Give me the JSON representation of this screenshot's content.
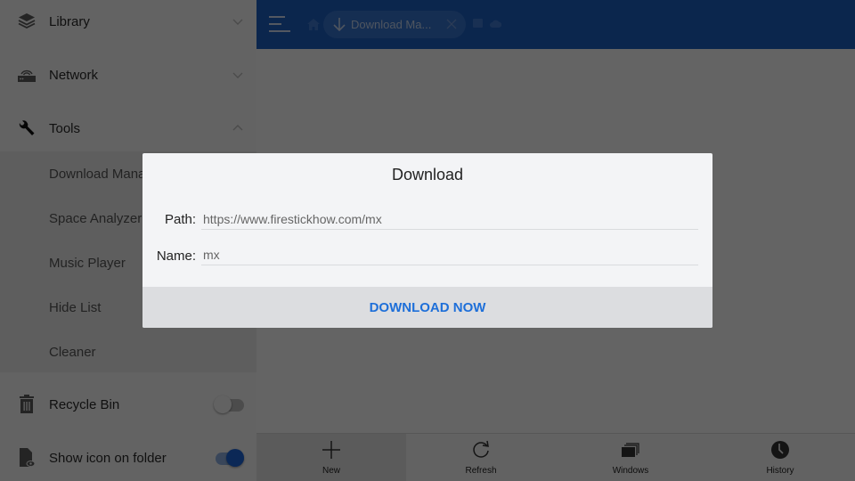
{
  "sidebar": {
    "sections": [
      {
        "label": "Library",
        "icon": "layers-icon",
        "expanded": false
      },
      {
        "label": "Network",
        "icon": "router-icon",
        "expanded": false
      },
      {
        "label": "Tools",
        "icon": "wrench-icon",
        "expanded": true
      }
    ],
    "tools_items": [
      {
        "label": "Download Manager"
      },
      {
        "label": "Space Analyzer"
      },
      {
        "label": "Music Player"
      },
      {
        "label": "Hide List"
      },
      {
        "label": "Cleaner"
      }
    ],
    "settings": [
      {
        "label": "Recycle Bin",
        "icon": "trash-icon",
        "toggle_on": false
      },
      {
        "label": "Show icon on folder",
        "icon": "file-eye-icon",
        "toggle_on": true
      }
    ]
  },
  "header": {
    "tab_label": "Download Ma...",
    "colors": {
      "bar": "#1d5fc0",
      "accent": "#1e6fd9"
    }
  },
  "bottom_toolbar": {
    "items": [
      {
        "label": "New",
        "icon": "plus-icon",
        "active": true
      },
      {
        "label": "Refresh",
        "icon": "refresh-icon",
        "active": false
      },
      {
        "label": "Windows",
        "icon": "windows-icon",
        "active": false
      },
      {
        "label": "History",
        "icon": "clock-icon",
        "active": false
      }
    ]
  },
  "dialog": {
    "title": "Download",
    "path_label": "Path:",
    "path_value": "https://www.firestickhow.com/mx",
    "name_label": "Name:",
    "name_value": "mx",
    "action_label": "DOWNLOAD NOW"
  }
}
